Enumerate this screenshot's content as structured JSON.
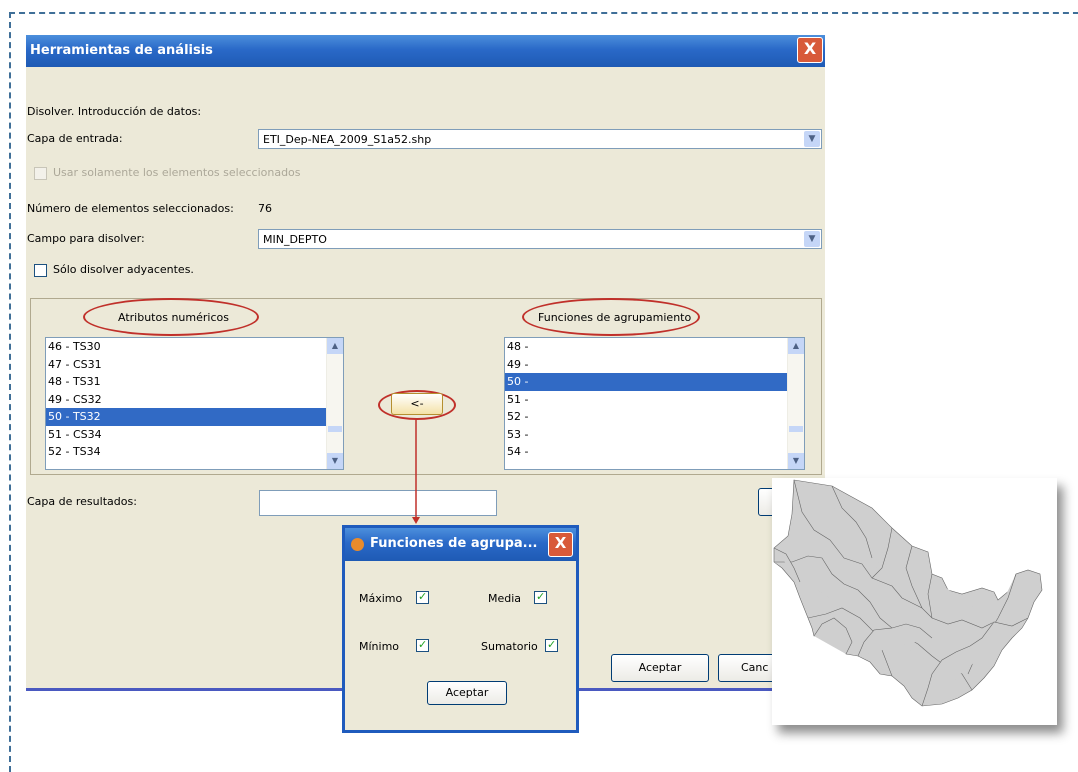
{
  "dialog": {
    "title": "Herramientas de análisis",
    "close_label": "X",
    "section_label": "Disolver. Introducción de datos:",
    "input_layer_label": "Capa de entrada:",
    "input_layer_value": "ETI_Dep-NEA_2009_S1a52.shp",
    "use_selected_label": "Usar solamente los elementos seleccionados",
    "selected_count_label": "Número de elementos seleccionados:",
    "selected_count_value": "76",
    "dissolve_field_label": "Campo para disolver:",
    "dissolve_field_value": "MIN_DEPTO",
    "only_adjacent_label": "Sólo disolver adyacentes.",
    "numeric_attrs_header": "Atributos numéricos",
    "group_functions_header": "Funciones de agrupamiento",
    "numeric_attrs": [
      "46 - TS30",
      "47 - CS31",
      "48 - TS31",
      "49 - CS32",
      "50 - TS32",
      "51 - CS34",
      "52 - TS34"
    ],
    "numeric_attrs_selected": 4,
    "group_functions": [
      "48 -",
      "49 -",
      "50 -",
      "51 -",
      "52 -",
      "53 -",
      "54 -"
    ],
    "group_functions_selected": 2,
    "arrow_button_label": "<-",
    "result_layer_label": "Capa de resultados:",
    "accept_label": "Aceptar",
    "cancel_label": "Canc"
  },
  "popup": {
    "title": "Funciones de agrupa...",
    "close_label": "X",
    "max_label": "Máximo",
    "mean_label": "Media",
    "min_label": "Mínimo",
    "sum_label": "Sumatorio",
    "accept_label": "Aceptar",
    "max_checked": true,
    "mean_checked": true,
    "min_checked": true,
    "sum_checked": true
  },
  "colors": {
    "titlebar": "#2a69c8",
    "selection": "#316ac5",
    "annotation": "#c0302a",
    "dashed_border": "#3f6f98"
  }
}
